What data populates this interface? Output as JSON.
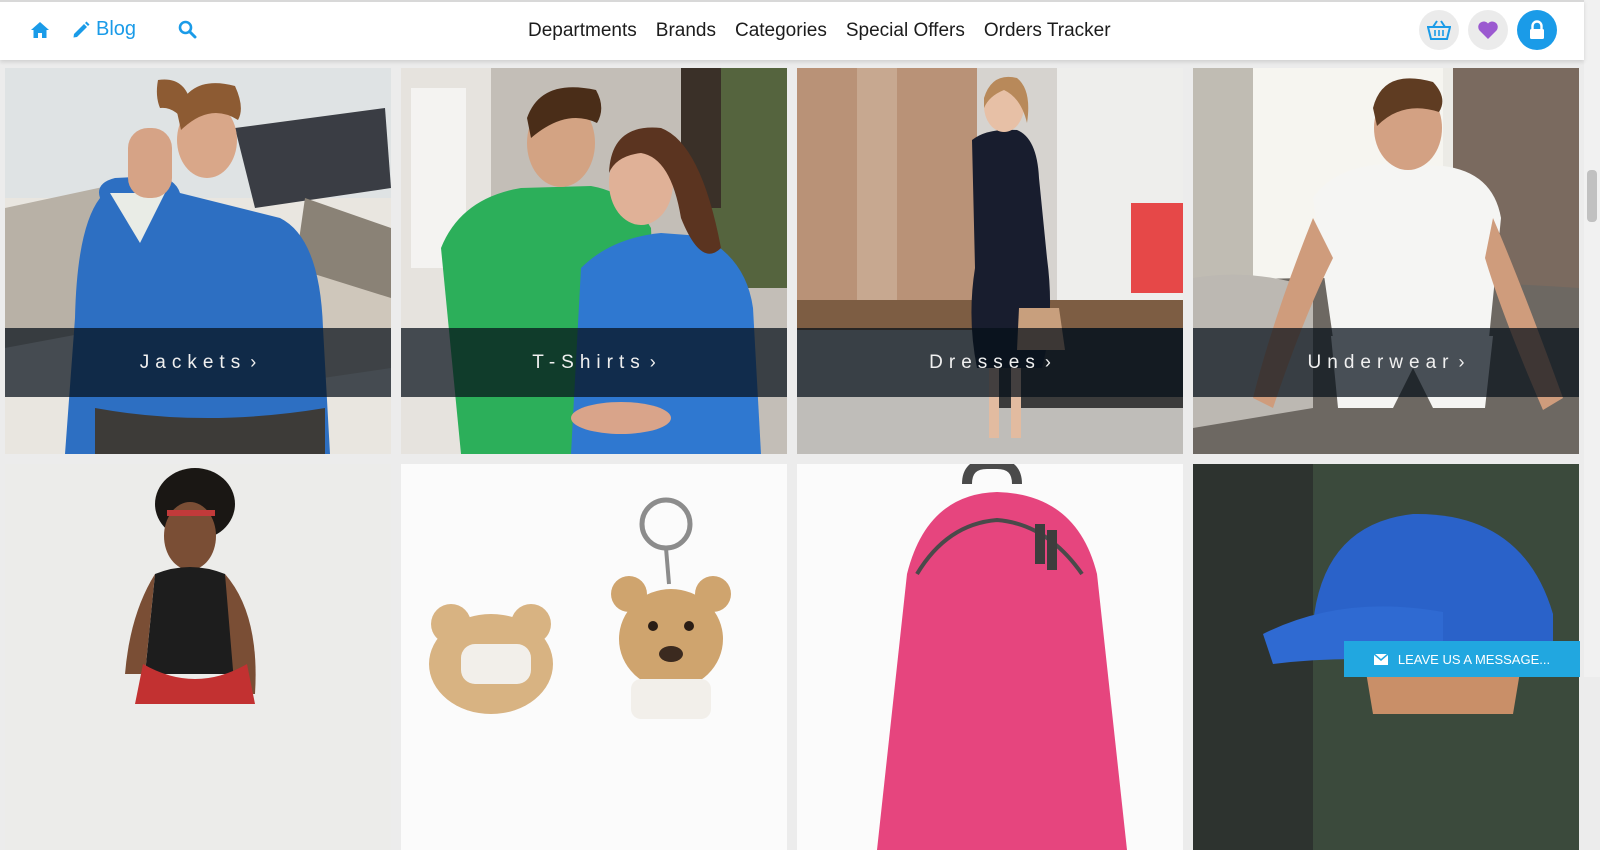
{
  "header": {
    "blog_label": "Blog",
    "nav": [
      {
        "label": "Departments"
      },
      {
        "label": "Brands"
      },
      {
        "label": "Categories"
      },
      {
        "label": "Special Offers"
      },
      {
        "label": "Orders Tracker"
      }
    ],
    "icons": [
      "home-icon",
      "pencil-icon",
      "search-icon",
      "basket-icon",
      "heart-icon",
      "lock-icon"
    ]
  },
  "categories": [
    {
      "label": "Jackets"
    },
    {
      "label": "T-Shirts"
    },
    {
      "label": "Dresses"
    },
    {
      "label": "Underwear"
    }
  ],
  "chat": {
    "label": "LEAVE US A MESSAGE..."
  },
  "colors": {
    "accent": "#1a9be8",
    "heart": "#9b59d0",
    "chat": "#21a7e0"
  }
}
